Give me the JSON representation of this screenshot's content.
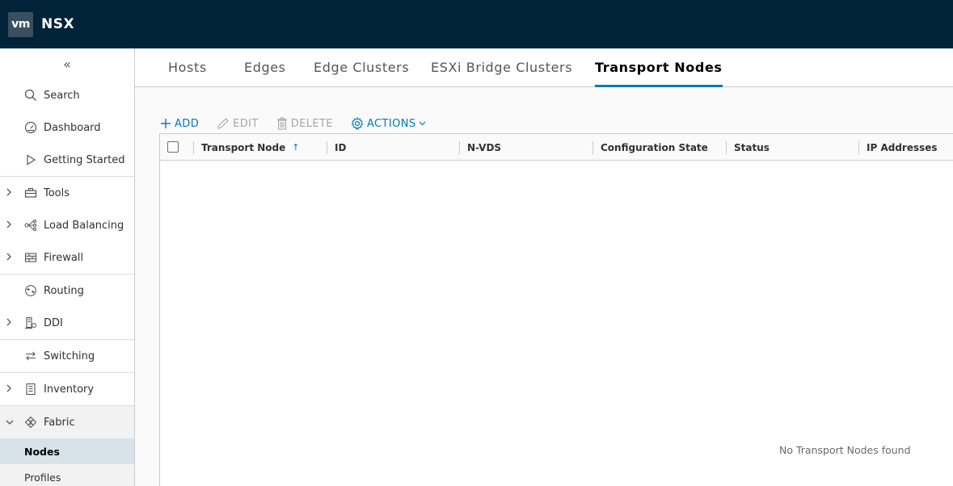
{
  "app": {
    "logo_text": "vm",
    "title": "NSX"
  },
  "sidebar": {
    "collapse_glyph": "«",
    "items": [
      {
        "label": "Search",
        "icon": "search-icon",
        "expandable": false
      },
      {
        "label": "Dashboard",
        "icon": "dashboard-icon",
        "expandable": false
      },
      {
        "label": "Getting Started",
        "icon": "play-icon",
        "expandable": false
      },
      {
        "label": "Tools",
        "icon": "toolbox-icon",
        "expandable": true
      },
      {
        "label": "Load Balancing",
        "icon": "load-balancer-icon",
        "expandable": true
      },
      {
        "label": "Firewall",
        "icon": "firewall-icon",
        "expandable": true
      },
      {
        "label": "Routing",
        "icon": "router-icon",
        "expandable": false
      },
      {
        "label": "DDI",
        "icon": "ddi-icon",
        "expandable": true
      },
      {
        "label": "Switching",
        "icon": "switch-icon",
        "expandable": false
      },
      {
        "label": "Inventory",
        "icon": "inventory-icon",
        "expandable": true
      },
      {
        "label": "Fabric",
        "icon": "fabric-icon",
        "expandable": true,
        "expanded": true
      }
    ],
    "fabric_children": [
      {
        "label": "Nodes",
        "active": true
      },
      {
        "label": "Profiles",
        "active": false
      }
    ]
  },
  "tabs": [
    {
      "label": "Hosts",
      "active": false
    },
    {
      "label": "Edges",
      "active": false
    },
    {
      "label": "Edge Clusters",
      "active": false
    },
    {
      "label": "ESXi Bridge Clusters",
      "active": false
    },
    {
      "label": "Transport Nodes",
      "active": true
    }
  ],
  "toolbar": {
    "add_label": "ADD",
    "edit_label": "EDIT",
    "delete_label": "DELETE",
    "actions_label": "ACTIONS"
  },
  "grid": {
    "columns": [
      "Transport Node",
      "ID",
      "N-VDS",
      "Configuration State",
      "Status",
      "IP Addresses"
    ],
    "sort_indicator": "↑",
    "empty_message": "No Transport Nodes found"
  },
  "colors": {
    "topbar": "#012339",
    "accent": "#0079b8",
    "active_nav": "#d8e3e9"
  }
}
